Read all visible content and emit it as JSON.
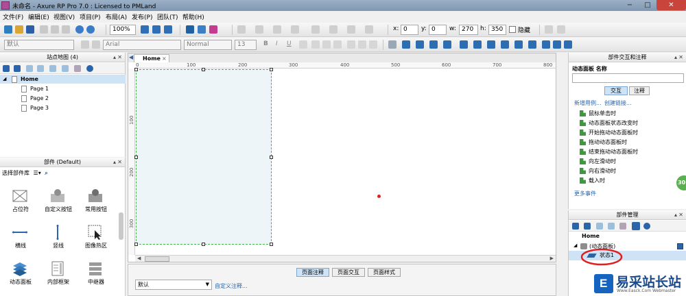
{
  "window": {
    "title": "未命名 - Axure RP Pro 7.0 : Licensed to PMLand",
    "minimize": "−",
    "maximize": "□",
    "close": "✕"
  },
  "menu": {
    "items": [
      "文件(F)",
      "编辑(E)",
      "视图(V)",
      "项目(P)",
      "布局(A)",
      "发布(P)",
      "团队(T)",
      "帮助(H)"
    ]
  },
  "toolbar": {
    "zoom": "100%",
    "x_label": "x:",
    "x_value": "0",
    "y_label": "y:",
    "y_value": "0",
    "w_label": "w:",
    "w_value": "270",
    "h_label": "h:",
    "h_value": "350",
    "hide_label": "隐藏",
    "style_value": "默认",
    "font_value": "Arial",
    "weight_value": "Normal",
    "size_value": "13",
    "bold": "B",
    "italic": "I",
    "underline": "U"
  },
  "sitemap": {
    "title": "站点地图 (4)",
    "root": "Home",
    "pages": [
      "Page 1",
      "Page 2",
      "Page 3"
    ]
  },
  "widgets": {
    "title": "部件 (Default)",
    "library_select": "选择部件库",
    "items": [
      "占位符",
      "自定义按钮",
      "常用按钮",
      "横线",
      "竖线",
      "图像热区",
      "动态面板",
      "内部框架",
      "中继器"
    ]
  },
  "canvas": {
    "tab": "Home",
    "tab_close": "×",
    "ruler_h": [
      "0",
      "100",
      "200",
      "300",
      "400",
      "500",
      "600",
      "700",
      "800"
    ],
    "ruler_v": [
      "100",
      "200",
      "300"
    ]
  },
  "notes": {
    "tabs": [
      "页面注释",
      "页面交互",
      "页面样式"
    ],
    "select_value": "默认",
    "custom_link": "自定义注释..."
  },
  "interactions": {
    "title": "部件交互和注释",
    "field_label": "动态面板 名称",
    "tabs": [
      "交互",
      "注释"
    ],
    "new_case": "新增用例...",
    "create_link": "创建链接...",
    "events": [
      "鼠标单击时",
      "动态面板状态改变时",
      "开始拖动动态面板时",
      "拖动动态面板时",
      "结束拖动动态面板时",
      "向左滑动时",
      "向右滑动时",
      "载入时"
    ],
    "more_events": "更多事件"
  },
  "outline": {
    "title": "部件管理",
    "root": "Home",
    "panel": "(动态面板)",
    "state": "状态1"
  },
  "badge": "30",
  "brand": {
    "name": "易采站长站",
    "url": "Www.Easck.Com Webmaster"
  },
  "colors": {
    "selection": "#cfe3f6",
    "panel_border": "#44b44a",
    "annotation_red": "#e02020",
    "event_icon": "#3c9a3c"
  }
}
